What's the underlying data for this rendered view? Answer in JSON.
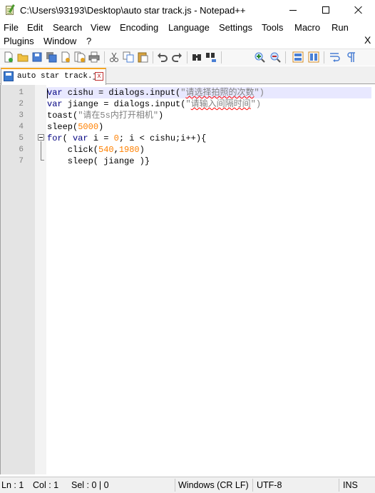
{
  "window": {
    "title": "C:\\Users\\93193\\Desktop\\auto star track.js - Notepad++",
    "controls": [
      "minimize",
      "maximize",
      "close"
    ]
  },
  "menu": {
    "row1": [
      "File",
      "Edit",
      "Search",
      "View",
      "Encoding",
      "Language",
      "Settings",
      "Tools",
      "Macro",
      "Run"
    ],
    "row2": [
      "Plugins",
      "Window",
      "?"
    ],
    "close_label": "X"
  },
  "toolbar": {
    "icons": [
      "new-file-icon",
      "open-file-icon",
      "save-icon",
      "save-all-icon",
      "close-icon",
      "close-all-icon",
      "print-icon",
      "cut-icon",
      "copy-icon",
      "paste-icon",
      "undo-icon",
      "redo-icon",
      "find-icon",
      "replace-icon",
      "zoom-in-icon",
      "zoom-out-icon",
      "sync-vertical-icon",
      "sync-horizontal-icon",
      "word-wrap-icon",
      "show-all-chars-icon"
    ]
  },
  "tabs": [
    {
      "label": "auto star track.js",
      "close": "x",
      "active": true
    }
  ],
  "editor": {
    "lines": [
      {
        "num": "1",
        "tokens": [
          {
            "t": "var",
            "c": "kw"
          },
          {
            "t": " cishu = dialogs.input(",
            "c": ""
          },
          {
            "t": "\"",
            "c": "str"
          },
          {
            "t": "请选择拍照的次数",
            "c": "str squig"
          },
          {
            "t": "\")",
            "c": "str"
          }
        ]
      },
      {
        "num": "2",
        "tokens": [
          {
            "t": "var",
            "c": "kw"
          },
          {
            "t": " jiange = dialogs.input(",
            "c": ""
          },
          {
            "t": "\"",
            "c": "str"
          },
          {
            "t": "请输入间隔时间",
            "c": "str squig"
          },
          {
            "t": "\")",
            "c": "str"
          }
        ]
      },
      {
        "num": "3",
        "tokens": [
          {
            "t": "toast(",
            "c": ""
          },
          {
            "t": "\"请在5s内打开相机\"",
            "c": "str"
          },
          {
            "t": ")",
            "c": ""
          }
        ]
      },
      {
        "num": "4",
        "tokens": [
          {
            "t": "sleep(",
            "c": ""
          },
          {
            "t": "5000",
            "c": "num"
          },
          {
            "t": ")",
            "c": ""
          }
        ]
      },
      {
        "num": "5",
        "tokens": [
          {
            "t": "for",
            "c": "kw"
          },
          {
            "t": "( ",
            "c": ""
          },
          {
            "t": "var",
            "c": "kw"
          },
          {
            "t": " i = ",
            "c": ""
          },
          {
            "t": "0",
            "c": "num"
          },
          {
            "t": "; i < cishu;i++){",
            "c": ""
          }
        ]
      },
      {
        "num": "6",
        "tokens": [
          {
            "t": "    click(",
            "c": ""
          },
          {
            "t": "540",
            "c": "num"
          },
          {
            "t": ",",
            "c": ""
          },
          {
            "t": "1980",
            "c": "num"
          },
          {
            "t": ")",
            "c": ""
          }
        ]
      },
      {
        "num": "7",
        "tokens": [
          {
            "t": "    sleep( jiange )}",
            "c": ""
          }
        ]
      }
    ]
  },
  "statusbar": {
    "ln": "Ln : 1",
    "col": "Col : 1",
    "sel": "Sel : 0 | 0",
    "eol": "Windows (CR LF)",
    "encoding": "UTF-8",
    "mode": "INS"
  }
}
